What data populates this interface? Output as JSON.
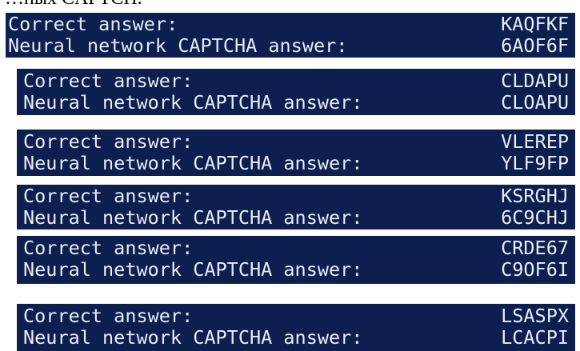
{
  "caption": "…ных CAPTCH.",
  "panels": [
    {
      "correct_label": "Correct answer:",
      "correct_value": "KAQFKF",
      "nn_label": "Neural network CAPTCHA answer:",
      "nn_value": "6AOF6F"
    },
    {
      "correct_label": "Correct answer:",
      "correct_value": "CLDAPU",
      "nn_label": "Neural network CAPTCHA answer:",
      "nn_value": "CLOAPU"
    },
    {
      "correct_label": "Correct answer:",
      "correct_value": "VLEREP",
      "nn_label": "Neural network CAPTCHA answer:",
      "nn_value": "YLF9FP"
    },
    {
      "correct_label": "Correct answer:",
      "correct_value": "KSRGHJ",
      "nn_label": "Neural network CAPTCHA answer:",
      "nn_value": "6C9CHJ"
    },
    {
      "correct_label": "Correct answer:",
      "correct_value": "CRDE67",
      "nn_label": "Neural network CAPTCHA answer:",
      "nn_value": "C9OF6I"
    },
    {
      "correct_label": "Correct answer:",
      "correct_value": "LSASPX",
      "nn_label": "Neural network CAPTCHA answer:",
      "nn_value": "LCACPI"
    }
  ],
  "colors": {
    "panel_background": "#0c1f4e",
    "panel_text": "#e6ecf5",
    "page_background": "#ffffff"
  }
}
